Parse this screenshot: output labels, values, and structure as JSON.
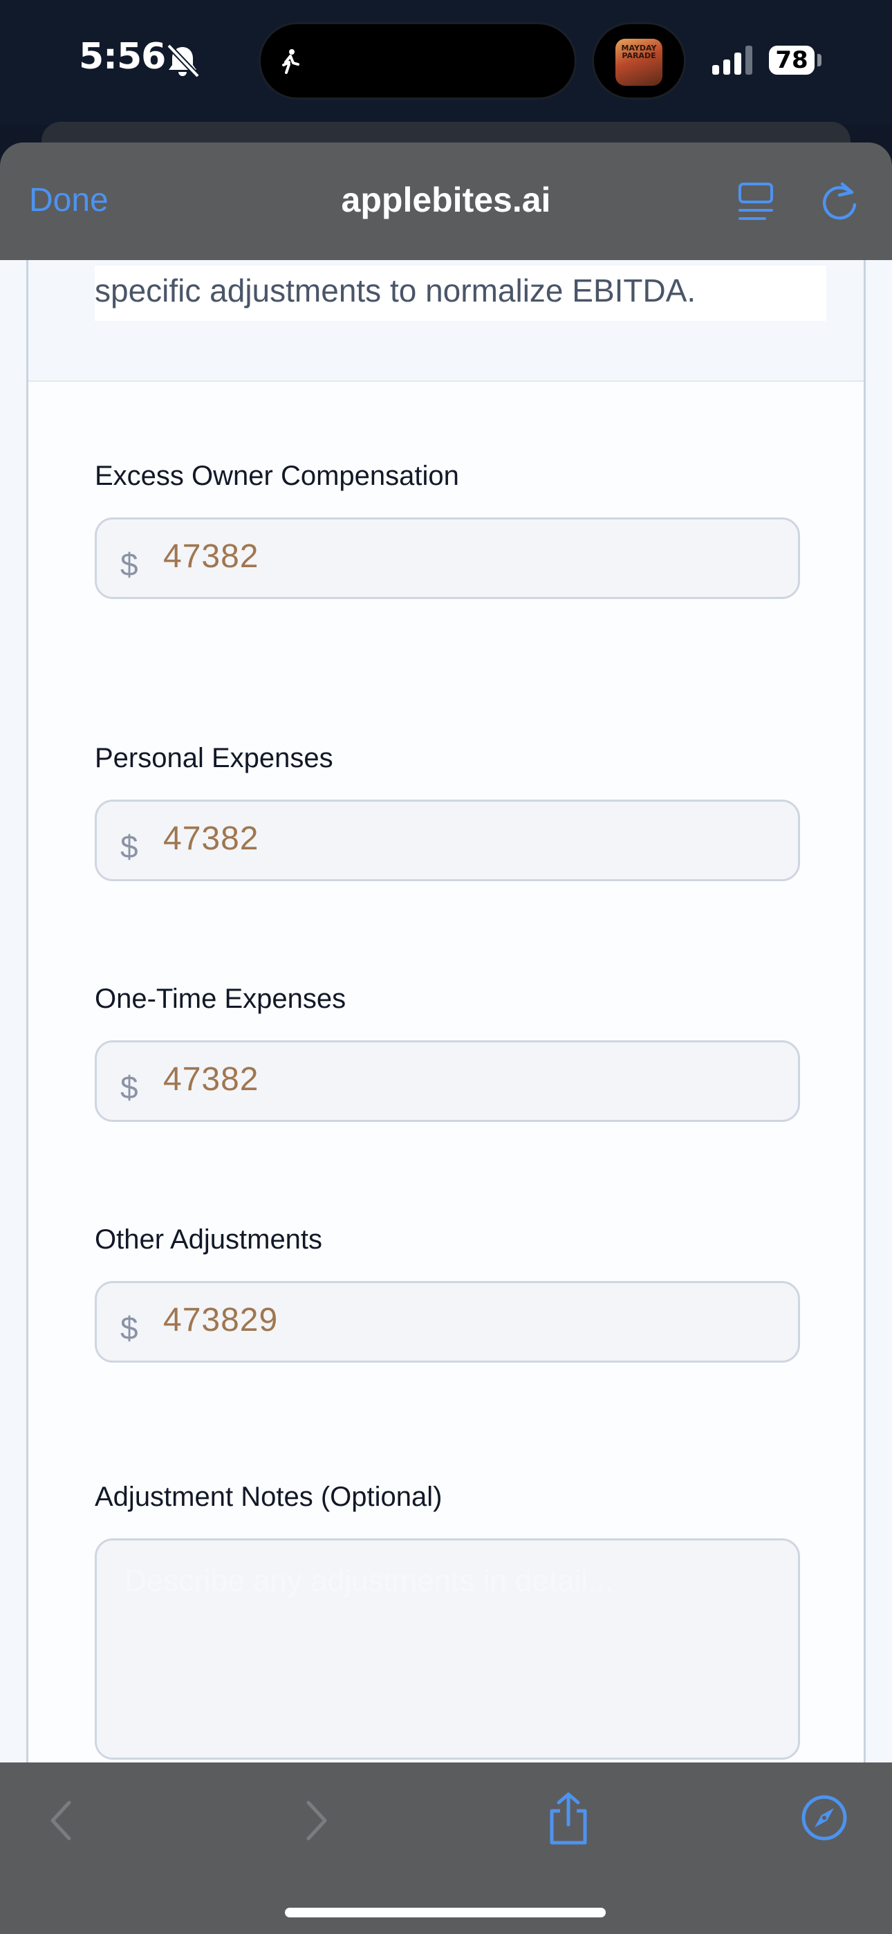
{
  "status_bar": {
    "time": "5:56",
    "battery": "78",
    "album_art_text": "MAYDAY PARADE",
    "icons": [
      "bell-off-icon",
      "walk-icon",
      "signal-icon",
      "battery-icon"
    ]
  },
  "browser": {
    "done_label": "Done",
    "site_title": "applebites.ai",
    "accent_color": "#4d93f0",
    "toolbar_icons": [
      "reader-icon",
      "reload-icon",
      "back-icon",
      "forward-icon",
      "share-icon",
      "compass-icon"
    ]
  },
  "page": {
    "intro_text": "specific adjustments to normalize EBITDA.",
    "currency_symbol": "$",
    "fields": [
      {
        "label": "Excess Owner Compensation",
        "value": "47382"
      },
      {
        "label": "Personal Expenses",
        "value": "47382"
      },
      {
        "label": "One-Time Expenses",
        "value": "47382"
      },
      {
        "label": "Other Adjustments",
        "value": "473829"
      }
    ],
    "notes": {
      "label": "Adjustment Notes (Optional)",
      "placeholder": "Describe any adjustments in detail..."
    }
  }
}
